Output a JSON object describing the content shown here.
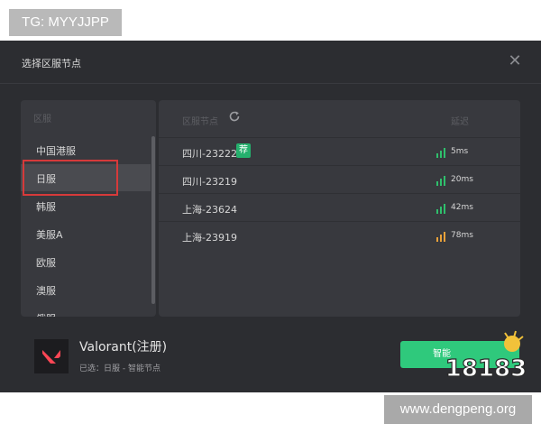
{
  "watermark_top": "TG: MYYJJPP",
  "watermark_bottom": "www.dengpeng.org",
  "dialog": {
    "title": "选择区服节点",
    "close_icon": "close-icon"
  },
  "regions": {
    "header": "区服",
    "items": [
      {
        "label": "中国港服"
      },
      {
        "label": "日服"
      },
      {
        "label": "韩服"
      },
      {
        "label": "美服A"
      },
      {
        "label": "欧服"
      },
      {
        "label": "澳服"
      },
      {
        "label": "俄服"
      }
    ],
    "selected_index": 1
  },
  "nodes": {
    "header_label": "区服节点",
    "latency_header": "延迟",
    "recommend_badge": "荐",
    "rows": [
      {
        "name": "四川-23222",
        "ping": "5ms",
        "color": "#2fbf6c"
      },
      {
        "name": "四川-23219",
        "ping": "20ms",
        "color": "#2fbf6c"
      },
      {
        "name": "上海-23624",
        "ping": "42ms",
        "color": "#2fbf6c"
      },
      {
        "name": "上海-23919",
        "ping": "78ms",
        "color": "#e8a13a"
      }
    ]
  },
  "game": {
    "title": "Valorant(注册)",
    "subtitle": "已选：日服 - 智能节点"
  },
  "start_button": "智能",
  "logo_text": "18183",
  "colors": {
    "accent": "#2fc97c",
    "highlight_box": "#d63a3a",
    "panel_bg": "#38393e",
    "dialog_bg": "#2c2d31"
  }
}
